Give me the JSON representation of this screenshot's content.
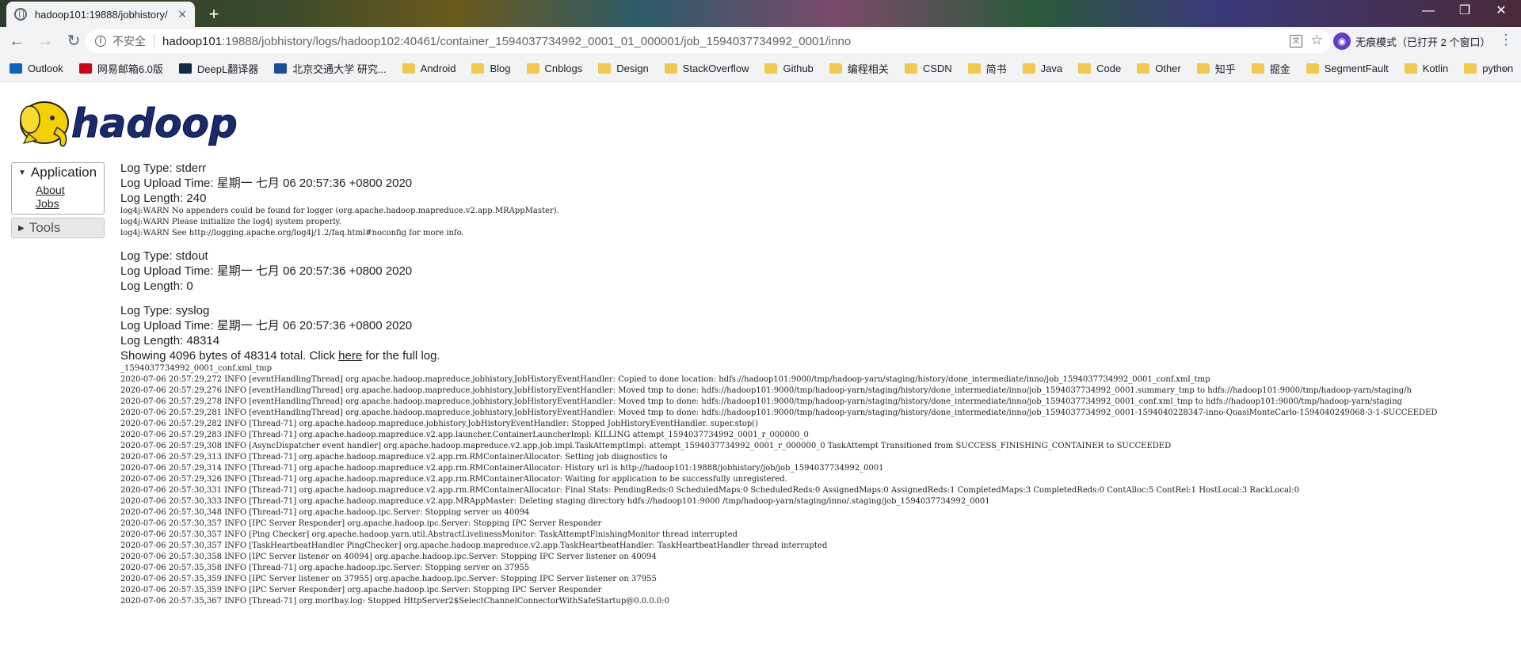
{
  "browser": {
    "tab_title": "hadoop101:19888/jobhistory/",
    "tab_close": "✕",
    "new_tab": "+",
    "window_controls": {
      "minimize": "—",
      "maximize": "❐",
      "close": "✕"
    },
    "security_label": "不安全",
    "url_host": "hadoop101",
    "url_rest": ":19888/jobhistory/logs/hadoop102:40461/container_1594037734992_0001_01_000001/job_1594037734992_0001/inno",
    "incognito_label": "无痕模式（已打开 2 个窗口）",
    "bookmarks": [
      {
        "label": "Outlook",
        "icon": "outlook",
        "color": "#0a64c2"
      },
      {
        "label": "网易邮箱6.0版",
        "icon": "netease",
        "color": "#d0021b"
      },
      {
        "label": "DeepL翻译器",
        "icon": "deepl",
        "color": "#0f2b46"
      },
      {
        "label": "北京交通大学 研究...",
        "icon": "bjtu",
        "color": "#1b4f9c"
      },
      {
        "label": "Android",
        "icon": "folder",
        "color": "#f2c94c"
      },
      {
        "label": "Blog",
        "icon": "folder",
        "color": "#f2c94c"
      },
      {
        "label": "Cnblogs",
        "icon": "folder",
        "color": "#f2c94c"
      },
      {
        "label": "Design",
        "icon": "folder",
        "color": "#f2c94c"
      },
      {
        "label": "StackOverflow",
        "icon": "folder",
        "color": "#f2c94c"
      },
      {
        "label": "Github",
        "icon": "folder",
        "color": "#f2c94c"
      },
      {
        "label": "编程相关",
        "icon": "folder",
        "color": "#f2c94c"
      },
      {
        "label": "CSDN",
        "icon": "folder",
        "color": "#f2c94c"
      },
      {
        "label": "简书",
        "icon": "folder",
        "color": "#f2c94c"
      },
      {
        "label": "Java",
        "icon": "folder",
        "color": "#f2c94c"
      },
      {
        "label": "Code",
        "icon": "folder",
        "color": "#f2c94c"
      },
      {
        "label": "Other",
        "icon": "folder",
        "color": "#f2c94c"
      },
      {
        "label": "知乎",
        "icon": "folder",
        "color": "#f2c94c"
      },
      {
        "label": "掘金",
        "icon": "folder",
        "color": "#f2c94c"
      },
      {
        "label": "SegmentFault",
        "icon": "folder",
        "color": "#f2c94c"
      },
      {
        "label": "Kotlin",
        "icon": "folder",
        "color": "#f2c94c"
      },
      {
        "label": "python",
        "icon": "folder",
        "color": "#f2c94c"
      }
    ],
    "bookmarks_more": "»"
  },
  "sidebar": {
    "application_label": "Application",
    "application_links": [
      "About",
      "Jobs"
    ],
    "tools_label": "Tools"
  },
  "logs": {
    "stderr": {
      "type": "Log Type: stderr",
      "upload": "Log Upload Time: 星期一 七月 06 20:57:36 +0800 2020",
      "length": "Log Length: 240",
      "lines": [
        "log4j:WARN No appenders could be found for logger (org.apache.hadoop.mapreduce.v2.app.MRAppMaster).",
        "log4j:WARN Please initialize the log4j system properly.",
        "log4j:WARN See http://logging.apache.org/log4j/1.2/faq.html#noconfig for more info."
      ]
    },
    "stdout": {
      "type": "Log Type: stdout",
      "upload": "Log Upload Time: 星期一 七月 06 20:57:36 +0800 2020",
      "length": "Log Length: 0"
    },
    "syslog": {
      "type": "Log Type: syslog",
      "upload": "Log Upload Time: 星期一 七月 06 20:57:36 +0800 2020",
      "length": "Log Length: 48314",
      "showing_prefix": "Showing 4096 bytes of 48314 total. Click ",
      "showing_link": "here",
      "showing_suffix": " for the full log.",
      "lines": [
        "_1594037734992_0001_conf.xml_tmp",
        "2020-07-06 20:57:29,272 INFO [eventHandlingThread] org.apache.hadoop.mapreduce.jobhistory.JobHistoryEventHandler: Copied to done location: hdfs://hadoop101:9000/tmp/hadoop-yarn/staging/history/done_intermediate/inno/job_1594037734992_0001_conf.xml_tmp",
        "2020-07-06 20:57:29,276 INFO [eventHandlingThread] org.apache.hadoop.mapreduce.jobhistory.JobHistoryEventHandler: Moved tmp to done: hdfs://hadoop101:9000/tmp/hadoop-yarn/staging/history/done_intermediate/inno/job_1594037734992_0001.summary_tmp to hdfs://hadoop101:9000/tmp/hadoop-yarn/staging/h",
        "2020-07-06 20:57:29,278 INFO [eventHandlingThread] org.apache.hadoop.mapreduce.jobhistory.JobHistoryEventHandler: Moved tmp to done: hdfs://hadoop101:9000/tmp/hadoop-yarn/staging/history/done_intermediate/inno/job_1594037734992_0001_conf.xml_tmp to hdfs://hadoop101:9000/tmp/hadoop-yarn/staging",
        "2020-07-06 20:57:29,281 INFO [eventHandlingThread] org.apache.hadoop.mapreduce.jobhistory.JobHistoryEventHandler: Moved tmp to done: hdfs://hadoop101:9000/tmp/hadoop-yarn/staging/history/done_intermediate/inno/job_1594037734992_0001-1594040228347-inno-QuasiMonteCarlo-1594040249068-3-1-SUCCEEDED",
        "2020-07-06 20:57:29,282 INFO [Thread-71] org.apache.hadoop.mapreduce.jobhistory.JobHistoryEventHandler: Stopped JobHistoryEventHandler. super.stop()",
        "2020-07-06 20:57:29,283 INFO [Thread-71] org.apache.hadoop.mapreduce.v2.app.launcher.ContainerLauncherImpl: KILLING attempt_1594037734992_0001_r_000000_0",
        "2020-07-06 20:57:29,308 INFO [AsyncDispatcher event handler] org.apache.hadoop.mapreduce.v2.app.job.impl.TaskAttemptImpl: attempt_1594037734992_0001_r_000000_0 TaskAttempt Transitioned from SUCCESS_FINISHING_CONTAINER to SUCCEEDED",
        "2020-07-06 20:57:29,313 INFO [Thread-71] org.apache.hadoop.mapreduce.v2.app.rm.RMContainerAllocator: Setting job diagnostics to",
        "2020-07-06 20:57:29,314 INFO [Thread-71] org.apache.hadoop.mapreduce.v2.app.rm.RMContainerAllocator: History url is http://hadoop101:19888/jobhistory/job/job_1594037734992_0001",
        "2020-07-06 20:57:29,326 INFO [Thread-71] org.apache.hadoop.mapreduce.v2.app.rm.RMContainerAllocator: Waiting for application to be successfully unregistered.",
        "2020-07-06 20:57:30,331 INFO [Thread-71] org.apache.hadoop.mapreduce.v2.app.rm.RMContainerAllocator: Final Stats: PendingReds:0 ScheduledMaps:0 ScheduledReds:0 AssignedMaps:0 AssignedReds:1 CompletedMaps:3 CompletedReds:0 ContAlloc:5 ContRel:1 HostLocal:3 RackLocal:0",
        "2020-07-06 20:57:30,333 INFO [Thread-71] org.apache.hadoop.mapreduce.v2.app.MRAppMaster: Deleting staging directory hdfs://hadoop101:9000 /tmp/hadoop-yarn/staging/inno/.staging/job_1594037734992_0001",
        "2020-07-06 20:57:30,348 INFO [Thread-71] org.apache.hadoop.ipc.Server: Stopping server on 40094",
        "2020-07-06 20:57:30,357 INFO [IPC Server Responder] org.apache.hadoop.ipc.Server: Stopping IPC Server Responder",
        "2020-07-06 20:57:30,357 INFO [Ping Checker] org.apache.hadoop.yarn.util.AbstractLivelinessMonitor: TaskAttemptFinishingMonitor thread interrupted",
        "2020-07-06 20:57:30,357 INFO [TaskHeartbeatHandler PingChecker] org.apache.hadoop.mapreduce.v2.app.TaskHeartbeatHandler: TaskHeartbeatHandler thread interrupted",
        "2020-07-06 20:57:30,358 INFO [IPC Server listener on 40094] org.apache.hadoop.ipc.Server: Stopping IPC Server listener on 40094",
        "2020-07-06 20:57:35,358 INFO [Thread-71] org.apache.hadoop.ipc.Server: Stopping server on 37955",
        "2020-07-06 20:57:35,359 INFO [IPC Server listener on 37955] org.apache.hadoop.ipc.Server: Stopping IPC Server listener on 37955",
        "2020-07-06 20:57:35,359 INFO [IPC Server Responder] org.apache.hadoop.ipc.Server: Stopping IPC Server Responder",
        "2020-07-06 20:57:35,367 INFO [Thread-71] org.mortbay.log: Stopped HttpServer2$SelectChannelConnectorWithSafeStartup@0.0.0.0:0"
      ]
    }
  }
}
